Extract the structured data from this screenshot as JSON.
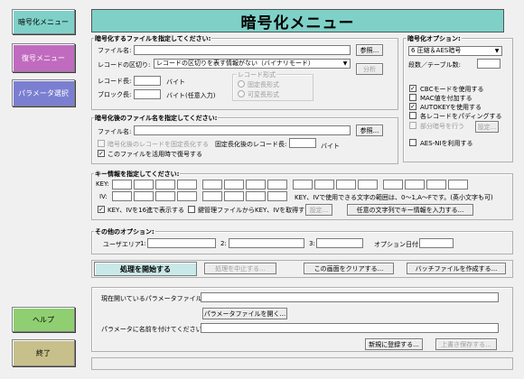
{
  "nav": {
    "encrypt_menu": "暗号化メニュー",
    "decrypt_menu": "復号メニュー",
    "param_select": "パラメータ選択",
    "help": "ヘルプ",
    "exit": "終了"
  },
  "colors": {
    "nav_active": "#7fd1c8",
    "nav_decrypt": "#c06bbf",
    "nav_param": "#7b7fd1",
    "nav_help": "#8fcf72",
    "nav_exit": "#c7c08a",
    "title_bg": "#7fd1c8"
  },
  "title": "暗号化メニュー",
  "file_section": {
    "title": "暗号化するファイルを指定してください:",
    "filename_label": "ファイル名:",
    "filename_value": "",
    "browse_button": "参照...",
    "record_sep_label": "レコードの区切り:",
    "record_sep_value": "レコードの区切りを表す情報がない（バイナリモード）",
    "split_button": "分析",
    "record_len_label": "レコード長:",
    "record_len_value": "",
    "bytes_label": "バイト",
    "block_len_label": "ブロック長:",
    "block_len_value": "",
    "bytes_optional_label": "バイト(任意入力)",
    "record_format_title": "レコード形式",
    "fixed_format": "固定長形式",
    "variable_format": "可変長形式"
  },
  "options_section": {
    "title": "暗号化オプション:",
    "algo_value": "6 圧縮＆AES暗号",
    "cycles_label": "段数／テーブル数:",
    "cycles_value": "",
    "cbc_label": "CBCモードを使用する",
    "mac_label": "MAC値を付加する",
    "autokey_label": "AUTOKEYを使用する",
    "padding_label": "各レコードをパディングする",
    "partial_label": "部分暗号を行う",
    "settings_button": "設定...",
    "aesni_label": "AES-NIを利用する"
  },
  "output_section": {
    "title": "暗号化後のファイル名を指定してください:",
    "filename_label": "ファイル名:",
    "filename_value": "",
    "browse_button": "参照...",
    "fixed_len_check_label": "暗号化後のレコードを固定長化する",
    "fixed_len_record_label": "固定長化後のレコード長:",
    "fixed_len_value": "",
    "bytes_label": "バイト",
    "overwrite_label": "このファイルを活用時で復号する"
  },
  "key_section": {
    "title": "キー情報を指定してください:",
    "key_label": "KEY:",
    "iv_label": "IV:",
    "hint": "KEY、IVで使用できる文字の範囲は、0～1,A～Fです。(英小文字も可)",
    "hex_display_label": "KEY、IVを16進で表示する",
    "key_mgmt_label": "鍵管理ファイルからKEY、IVを取得する",
    "settings_button": "設定...",
    "arbitrary_button": "任意の文字列でキー情報を入力する..."
  },
  "other_section": {
    "title": "その他のオプション:",
    "user_area_label": "ユーザエリア",
    "area1_label": "1:",
    "area2_label": "2:",
    "area3_label": "3:",
    "option_date_label": "オプション日付:",
    "area1_value": "",
    "area2_value": "",
    "area3_value": "",
    "date_value": ""
  },
  "actions": {
    "start_button": "処理を開始する",
    "cancel_button": "処理を中止する...",
    "clear_button": "この画面をクリアする...",
    "batch_button": "バッチファイルを作成する..."
  },
  "param_section": {
    "current_param_label": "現在開いているパラメータファイル:",
    "current_param_value": "",
    "open_param_button": "パラメータファイルを開く...",
    "save_name_label": "パラメータに名前を付けてください:",
    "save_name_value": "",
    "register_button": "新規に登録する...",
    "overwrite_button": "上書き保存する..."
  }
}
